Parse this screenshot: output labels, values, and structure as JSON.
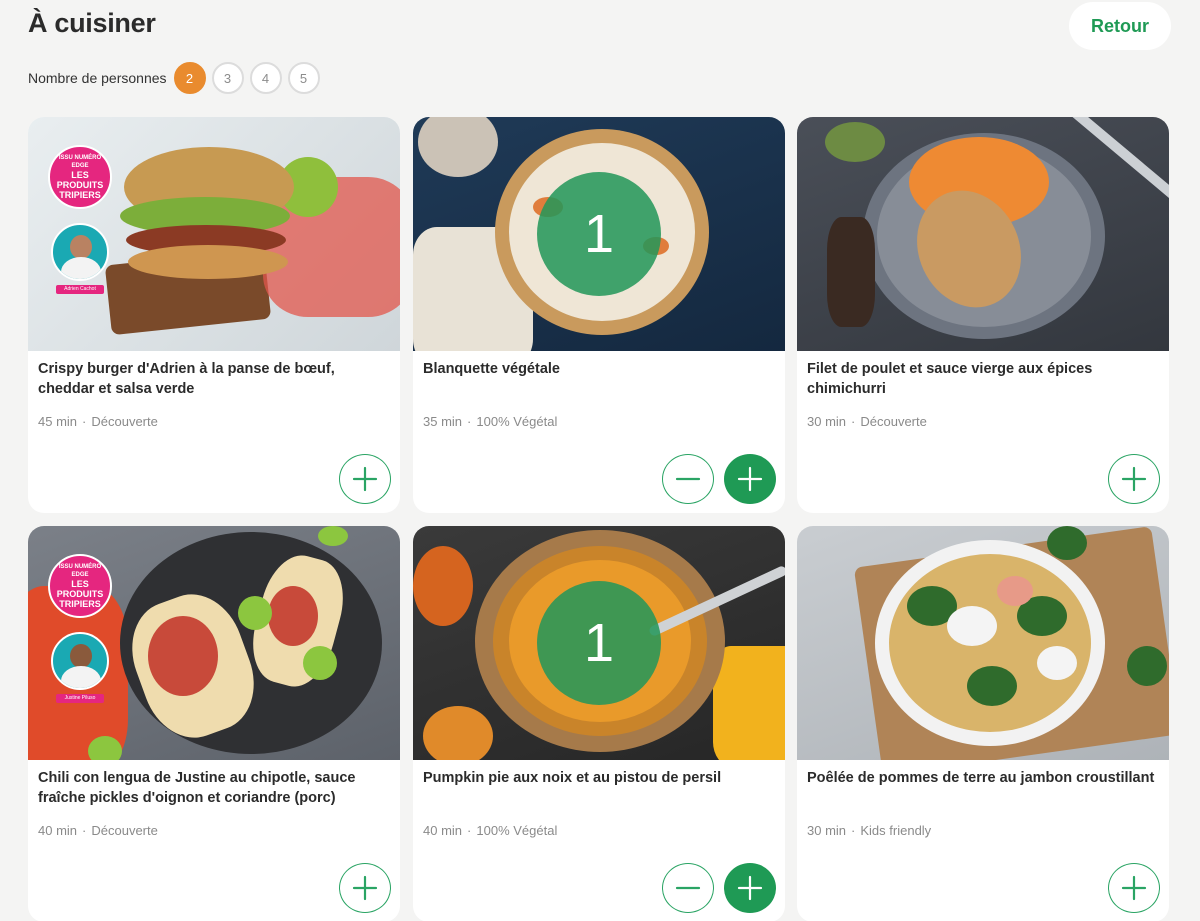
{
  "header": {
    "title": "À cuisiner",
    "back_label": "Retour"
  },
  "persons": {
    "label": "Nombre de personnes",
    "options": [
      "2",
      "3",
      "4",
      "5"
    ],
    "selected": "2"
  },
  "recipes": [
    {
      "title": "Crispy burger d'Adrien à la panse de bœuf, cheddar et salsa verde",
      "time": "45 min",
      "category": "Découverte",
      "quantity": null,
      "badge": {
        "top": "ISSU NUMÉRO EDGE",
        "line1": "LES",
        "line2": "PRODUITS",
        "line3": "TRIPIERS"
      },
      "chef_name": "Adrien Cachot"
    },
    {
      "title": "Blanquette végétale",
      "time": "35 min",
      "category": "100% Végétal",
      "quantity": "1"
    },
    {
      "title": "Filet de poulet et sauce vierge aux épices chimichurri",
      "time": "30 min",
      "category": "Découverte",
      "quantity": null
    },
    {
      "title": "Chili con lengua de Justine au chipotle, sauce fraîche pickles d'oignon et coriandre (porc)",
      "time": "40 min",
      "category": "Découverte",
      "quantity": null,
      "badge": {
        "top": "ISSU NUMÉRO EDGE",
        "line1": "LES",
        "line2": "PRODUITS",
        "line3": "TRIPIERS"
      },
      "chef_name": "Justine Piluso"
    },
    {
      "title": "Pumpkin pie aux noix et au pistou de persil",
      "time": "40 min",
      "category": "100% Végétal",
      "quantity": "1"
    },
    {
      "title": "Poêlée de pommes de terre au jambon croustillant",
      "time": "30 min",
      "category": "Kids friendly",
      "quantity": null
    }
  ],
  "colors": {
    "accent_green": "#1f9a55",
    "selected_orange": "#e98b2e",
    "badge_pink": "#e5267f"
  }
}
